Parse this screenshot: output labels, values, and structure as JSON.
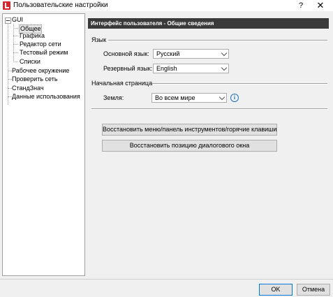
{
  "window": {
    "title": "Пользовательские настройки",
    "help": "?",
    "close": "✕"
  },
  "tree": {
    "root": "GUI",
    "children": [
      "Общее",
      "Графика",
      "Редактор сети",
      "Тестовый режим",
      "Списки"
    ],
    "items": [
      "Рабочее окружение",
      "Проверить сеть",
      "СтандЗнач",
      "Данные использования"
    ],
    "selected": "Общее"
  },
  "panel": {
    "header": "Интерфейс пользователя - Общие сведения",
    "language_group": "Язык",
    "primary_label": "Основной язык:",
    "primary_value": "Русский",
    "fallback_label": "Резервный язык:",
    "fallback_value": "English",
    "startpage_group": "Начальная страница",
    "earth_label": "Земля:",
    "earth_value": "Во всем мире",
    "info": "i",
    "restore_menus": "Восстановить меню/панель инструментов/горячие клавиши",
    "restore_dialog": "Восстановить позицию диалогового окна"
  },
  "footer": {
    "ok": "OK",
    "cancel": "Отмена"
  }
}
